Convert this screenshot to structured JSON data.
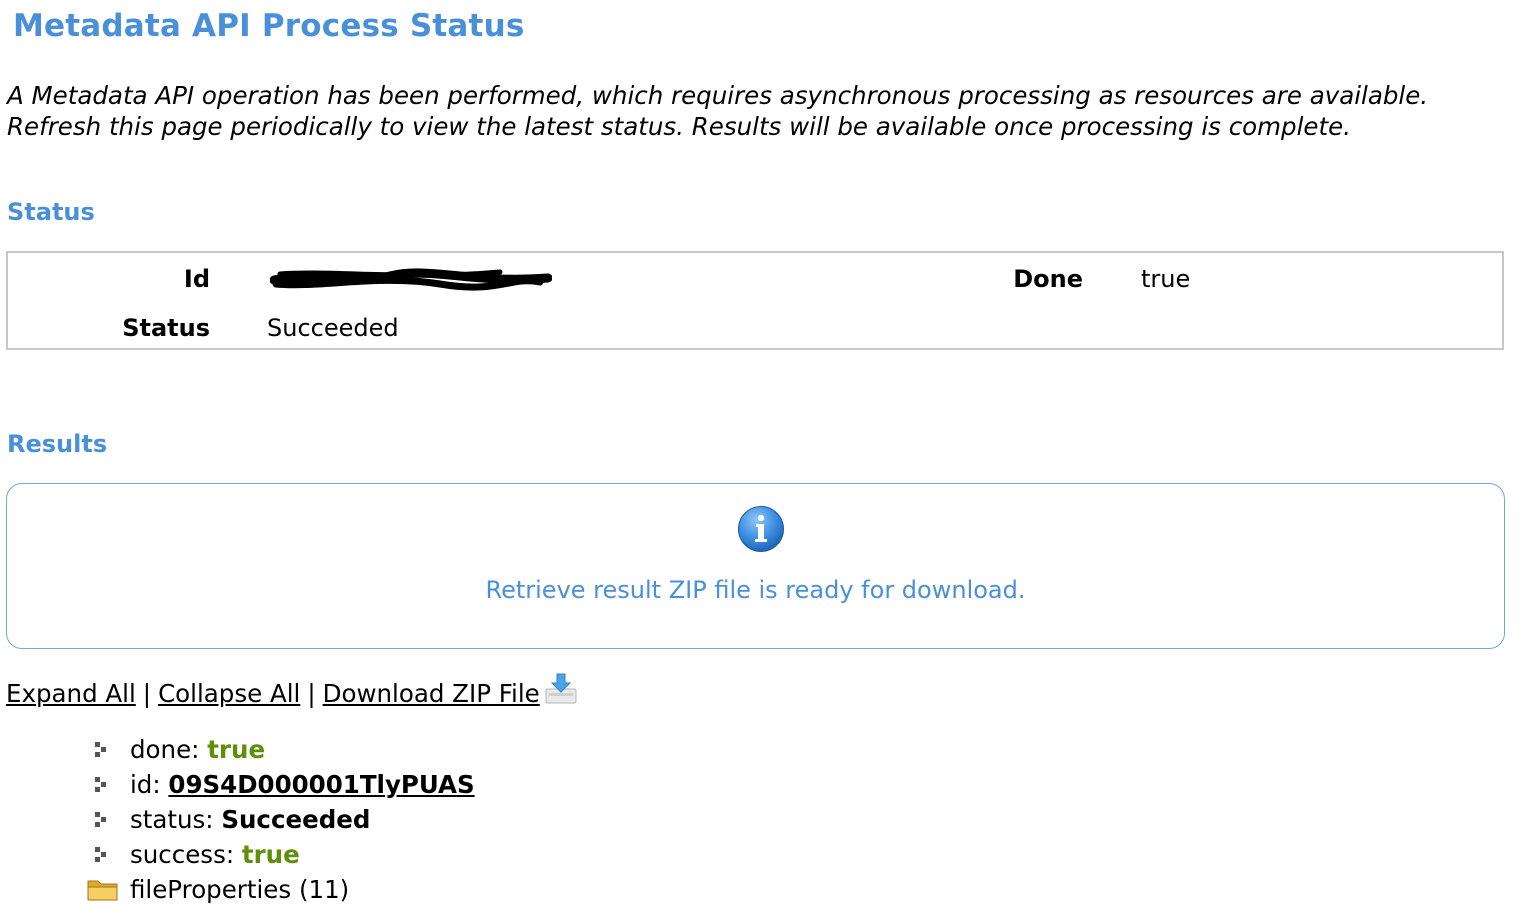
{
  "page": {
    "title": "Metadata API Process Status",
    "intro": "A Metadata API operation has been performed, which requires asynchronous processing as resources are available. Refresh this page periodically to view the latest status. Results will be available once processing is complete."
  },
  "status_section": {
    "heading": "Status",
    "id_label": "Id",
    "done_label": "Done",
    "done_value": "true",
    "status_label": "Status",
    "status_value": "Succeeded"
  },
  "results_section": {
    "heading": "Results",
    "message": "Retrieve result ZIP file is ready for download.",
    "info_icon": "info-icon"
  },
  "actions": {
    "expand_all": "Expand All",
    "collapse_all": "Collapse All",
    "download_zip": "Download ZIP File",
    "separator": "|",
    "download_icon": "download-icon"
  },
  "tree": {
    "items": [
      {
        "key": "done:",
        "value": "true"
      },
      {
        "key": "id:",
        "value": "09S4D000001TlyPUAS"
      },
      {
        "key": "status:",
        "value": "Succeeded"
      },
      {
        "key": "success:",
        "value": "true"
      },
      {
        "key": "fileProperties",
        "value": "(11)"
      }
    ]
  },
  "colors": {
    "heading_blue": "#4a90d9",
    "value_green": "#5e8f0a",
    "box_border_gray": "#c8c8c8",
    "results_border_blue": "#6fa8dc"
  }
}
